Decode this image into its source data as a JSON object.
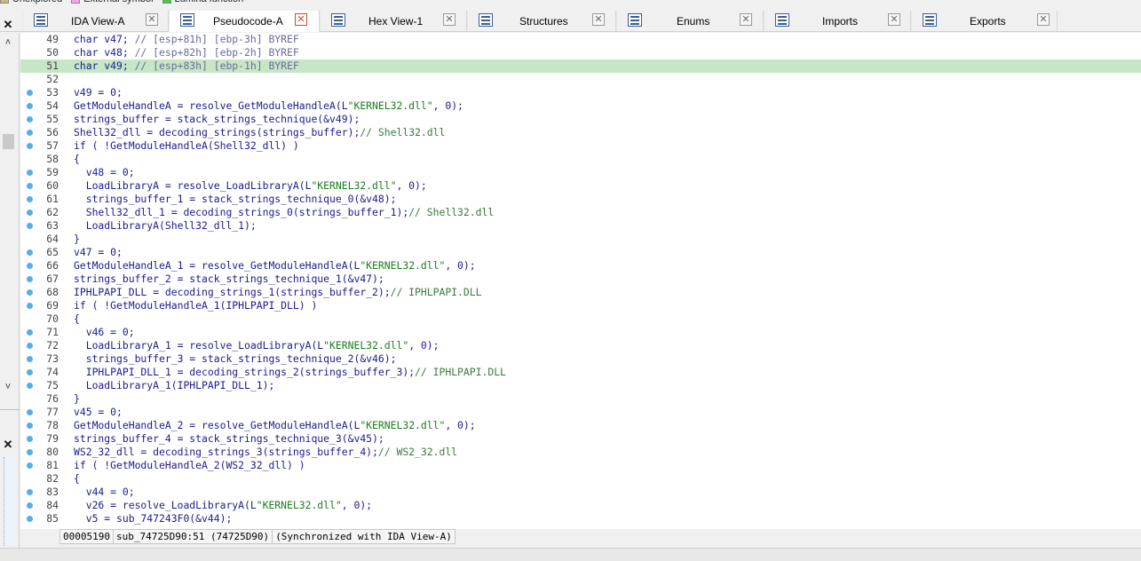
{
  "legend": [
    {
      "label": "Unexplored",
      "color": "#c8b98a"
    },
    {
      "label": "External symbol",
      "color": "#f2a6e6"
    },
    {
      "label": "Lumina function",
      "color": "#4cc24c"
    }
  ],
  "tabs": [
    {
      "label": "IDA View-A",
      "icon": "ida-view-icon",
      "active": false
    },
    {
      "label": "Pseudocode-A",
      "icon": "pseudocode-icon",
      "active": true
    },
    {
      "label": "Hex View-1",
      "icon": "hex-view-icon",
      "active": false
    },
    {
      "label": "Structures",
      "icon": "structures-icon",
      "active": false
    },
    {
      "label": "Enums",
      "icon": "enums-icon",
      "active": false
    },
    {
      "label": "Imports",
      "icon": "imports-icon",
      "active": false
    },
    {
      "label": "Exports",
      "icon": "exports-icon",
      "active": false
    }
  ],
  "tab_close_glyph": "✕",
  "left_panel": {
    "close_glyph": "✕",
    "up_glyph": "˄",
    "down_glyph": "˅"
  },
  "code_lines": [
    {
      "n": "49",
      "bp": false,
      "hl": false,
      "html": "char v47; <span class='t-gray'>// [esp+81h] [ebp-3h] BYREF</span>"
    },
    {
      "n": "50",
      "bp": false,
      "hl": false,
      "html": "char v48; <span class='t-gray'>// [esp+82h] [ebp-2h] BYREF</span>"
    },
    {
      "n": "51",
      "bp": false,
      "hl": true,
      "html": "char v49; <span class='t-gray'>// [esp+83h] [ebp-1h] BYREF</span>"
    },
    {
      "n": "52",
      "bp": false,
      "hl": false,
      "html": ""
    },
    {
      "n": "53",
      "bp": true,
      "hl": false,
      "html": "v49 = 0;"
    },
    {
      "n": "54",
      "bp": true,
      "hl": false,
      "html": "GetModuleHandleA = resolve_GetModuleHandleA(L<span class='t-str'>\"KERNEL32.dll\"</span>, 0);"
    },
    {
      "n": "55",
      "bp": true,
      "hl": false,
      "html": "strings_buffer = stack_strings_technique(&amp;v49);"
    },
    {
      "n": "56",
      "bp": true,
      "hl": false,
      "html": "Shell32_dll = decoding_strings(strings_buffer);<span class='t-cmt'>// Shell32.dll</span>"
    },
    {
      "n": "57",
      "bp": true,
      "hl": false,
      "html": "if ( !GetModuleHandleA(Shell32_dll) )"
    },
    {
      "n": "58",
      "bp": false,
      "hl": false,
      "html": "{"
    },
    {
      "n": "59",
      "bp": true,
      "hl": false,
      "html": "  v48 = 0;"
    },
    {
      "n": "60",
      "bp": true,
      "hl": false,
      "html": "  LoadLibraryA = resolve_LoadLibraryA(L<span class='t-str'>\"KERNEL32.dll\"</span>, 0);"
    },
    {
      "n": "61",
      "bp": true,
      "hl": false,
      "html": "  strings_buffer_1 = stack_strings_technique_0(&amp;v48);"
    },
    {
      "n": "62",
      "bp": true,
      "hl": false,
      "html": "  Shell32_dll_1 = decoding_strings_0(strings_buffer_1);<span class='t-cmt'>// Shell32.dll</span>"
    },
    {
      "n": "63",
      "bp": true,
      "hl": false,
      "html": "  LoadLibraryA(Shell32_dll_1);"
    },
    {
      "n": "64",
      "bp": false,
      "hl": false,
      "html": "}"
    },
    {
      "n": "65",
      "bp": true,
      "hl": false,
      "html": "v47 = 0;"
    },
    {
      "n": "66",
      "bp": true,
      "hl": false,
      "html": "GetModuleHandleA_1 = resolve_GetModuleHandleA(L<span class='t-str'>\"KERNEL32.dll\"</span>, 0);"
    },
    {
      "n": "67",
      "bp": true,
      "hl": false,
      "html": "strings_buffer_2 = stack_strings_technique_1(&amp;v47);"
    },
    {
      "n": "68",
      "bp": true,
      "hl": false,
      "html": "IPHLPAPI_DLL = decoding_strings_1(strings_buffer_2);<span class='t-cmt'>// IPHLPAPI.DLL</span>"
    },
    {
      "n": "69",
      "bp": true,
      "hl": false,
      "html": "if ( !GetModuleHandleA_1(IPHLPAPI_DLL) )"
    },
    {
      "n": "70",
      "bp": false,
      "hl": false,
      "html": "{"
    },
    {
      "n": "71",
      "bp": true,
      "hl": false,
      "html": "  v46 = 0;"
    },
    {
      "n": "72",
      "bp": true,
      "hl": false,
      "html": "  LoadLibraryA_1 = resolve_LoadLibraryA(L<span class='t-str'>\"KERNEL32.dll\"</span>, 0);"
    },
    {
      "n": "73",
      "bp": true,
      "hl": false,
      "html": "  strings_buffer_3 = stack_strings_technique_2(&amp;v46);"
    },
    {
      "n": "74",
      "bp": true,
      "hl": false,
      "html": "  IPHLPAPI_DLL_1 = decoding_strings_2(strings_buffer_3);<span class='t-cmt'>// IPHLPAPI.DLL</span>"
    },
    {
      "n": "75",
      "bp": true,
      "hl": false,
      "html": "  LoadLibraryA_1(IPHLPAPI_DLL_1);"
    },
    {
      "n": "76",
      "bp": false,
      "hl": false,
      "html": "}"
    },
    {
      "n": "77",
      "bp": true,
      "hl": false,
      "html": "v45 = 0;"
    },
    {
      "n": "78",
      "bp": true,
      "hl": false,
      "html": "GetModuleHandleA_2 = resolve_GetModuleHandleA(L<span class='t-str'>\"KERNEL32.dll\"</span>, 0);"
    },
    {
      "n": "79",
      "bp": true,
      "hl": false,
      "html": "strings_buffer_4 = stack_strings_technique_3(&amp;v45);"
    },
    {
      "n": "80",
      "bp": true,
      "hl": false,
      "html": "WS2_32_dll = decoding_strings_3(strings_buffer_4);<span class='t-cmt'>// WS2_32.dll</span>"
    },
    {
      "n": "81",
      "bp": true,
      "hl": false,
      "html": "if ( !GetModuleHandleA_2(WS2_32_dll) )"
    },
    {
      "n": "82",
      "bp": false,
      "hl": false,
      "html": "{"
    },
    {
      "n": "83",
      "bp": true,
      "hl": false,
      "html": "  v44 = 0;"
    },
    {
      "n": "84",
      "bp": true,
      "hl": false,
      "html": "  v26 = resolve_LoadLibraryA(L<span class='t-str'>\"KERNEL32.dll\"</span>, 0);"
    },
    {
      "n": "85",
      "bp": true,
      "hl": false,
      "html": "  v5 = sub_747243F0(&amp;v44);"
    }
  ],
  "status": {
    "offset": "00005190",
    "location": "sub_74725D90:51",
    "address": "(74725D90)",
    "sync": "(Synchronized with IDA View-A)"
  },
  "colors": {
    "highlight_line": "#c6e6c6",
    "breakpoint_dot": "#56aee6",
    "code_text": "#1b1b8e",
    "string_literal": "#1f7a1f",
    "comment": "#3a7a3a"
  }
}
